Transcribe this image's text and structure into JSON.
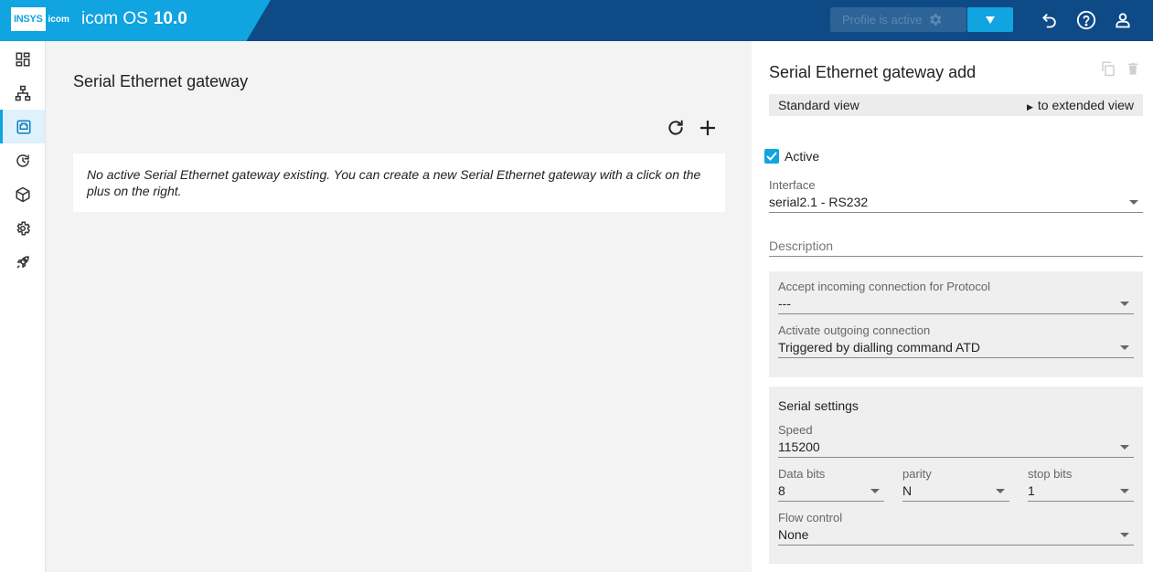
{
  "header": {
    "logo_text": "INSYS",
    "logo_sub": "icom",
    "app_name": "icom OS",
    "version": "10.0",
    "profile_label": "Profile is active",
    "colors": {
      "header": "#0d4a86",
      "brand": "#10a4e0"
    }
  },
  "sidebar": {
    "items": [
      {
        "icon": "dashboard-icon"
      },
      {
        "icon": "network-icon"
      },
      {
        "icon": "serial-port-icon",
        "active": true
      },
      {
        "icon": "history-icon"
      },
      {
        "icon": "package-icon"
      },
      {
        "icon": "gear-icon"
      },
      {
        "icon": "rocket-icon"
      }
    ]
  },
  "main": {
    "title": "Serial Ethernet gateway",
    "notice": "No active Serial Ethernet gateway existing. You can create a new Serial Ethernet gateway with a click on the plus on the right."
  },
  "panel": {
    "title": "Serial Ethernet gateway add",
    "view_current": "Standard view",
    "view_switch": "to extended view",
    "active_label": "Active",
    "active_checked": true,
    "interface": {
      "label": "Interface",
      "value": "serial2.1 - RS232"
    },
    "description": {
      "placeholder": "Description"
    },
    "incoming": {
      "label": "Accept incoming connection for Protocol",
      "value": "---"
    },
    "outgoing": {
      "label": "Activate outgoing connection",
      "value": "Triggered by dialling command ATD"
    },
    "serial": {
      "title": "Serial settings",
      "speed": {
        "label": "Speed",
        "value": "115200"
      },
      "data_bits": {
        "label": "Data bits",
        "value": "8"
      },
      "parity": {
        "label": "parity",
        "value": "N"
      },
      "stop_bits": {
        "label": "stop bits",
        "value": "1"
      },
      "flow": {
        "label": "Flow control",
        "value": "None"
      }
    }
  }
}
